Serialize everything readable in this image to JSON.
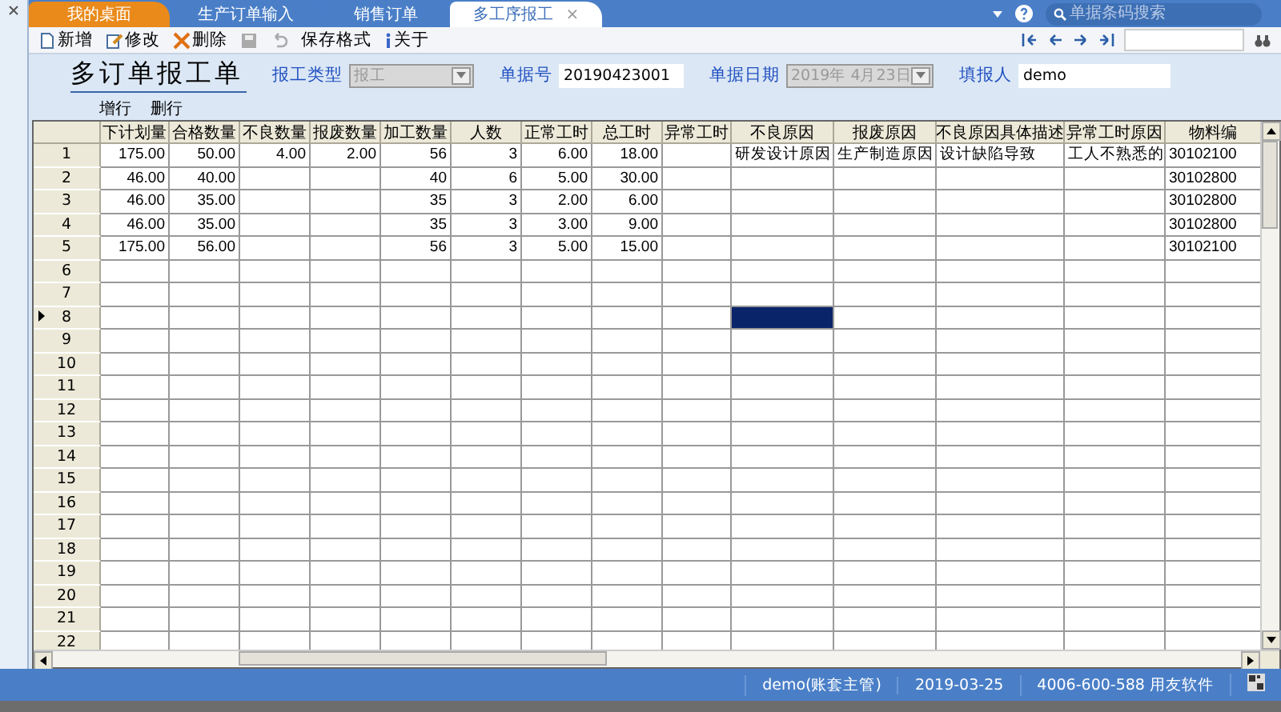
{
  "tabs": [
    {
      "label": "我的桌面",
      "kind": "home",
      "selected": false
    },
    {
      "label": "生产订单输入",
      "kind": "doc",
      "selected": false
    },
    {
      "label": "销售订单",
      "kind": "doc",
      "selected": false
    },
    {
      "label": "多工序报工",
      "kind": "doc",
      "selected": true,
      "close": "×"
    }
  ],
  "search": {
    "placeholder": "单据条码搜索"
  },
  "toolbar": [
    {
      "label": "新增",
      "kind": "new",
      "disabled": false
    },
    {
      "label": "修改",
      "kind": "edit",
      "disabled": false
    },
    {
      "label": "删除",
      "kind": "delete",
      "disabled": false
    },
    {
      "kind": "save",
      "disabled": true
    },
    {
      "kind": "undo",
      "disabled": true
    },
    {
      "label": "保存格式",
      "kind": "plain",
      "disabled": false
    },
    {
      "label": "关于",
      "kind": "info",
      "disabled": false
    }
  ],
  "form": {
    "title": "多订单报工单",
    "fields": [
      {
        "label": "报工类型",
        "value": "报工",
        "kind": "combo",
        "disabled": true
      },
      {
        "label": "单据号",
        "value": "20190423001",
        "kind": "text",
        "disabled": false
      },
      {
        "label": "单据日期",
        "value": "2019年 4月23日",
        "kind": "combo",
        "disabled": true
      },
      {
        "label": "填报人",
        "value": "demo",
        "kind": "text",
        "disabled": false
      }
    ],
    "actions": [
      "增行",
      "删行"
    ]
  },
  "grid": {
    "columns": [
      {
        "label": "下计划量",
        "kind": "number",
        "selected": false
      },
      {
        "label": "合格数量",
        "kind": "number",
        "selected": false
      },
      {
        "label": "不良数量",
        "kind": "number",
        "selected": false
      },
      {
        "label": "报废数量",
        "kind": "number",
        "selected": false
      },
      {
        "label": "加工数量",
        "kind": "number",
        "selected": false
      },
      {
        "label": "人数",
        "kind": "number",
        "selected": false
      },
      {
        "label": "正常工时",
        "kind": "number",
        "selected": false
      },
      {
        "label": "总工时",
        "kind": "number",
        "selected": false
      },
      {
        "label": "异常工时",
        "kind": "number",
        "selected": false
      },
      {
        "label": "不良原因",
        "kind": "text",
        "selected": true
      },
      {
        "label": "报废原因",
        "kind": "text",
        "selected": false
      },
      {
        "label": "不良原因具体描述",
        "kind": "text",
        "selected": false
      },
      {
        "label": "异常工时原因",
        "kind": "text",
        "selected": false
      },
      {
        "label": "物料编",
        "kind": "text",
        "selected": false
      }
    ],
    "rows": [
      {
        "number": "1",
        "current": false,
        "cells": [
          "175.00",
          "50.00",
          "4.00",
          "2.00",
          "56",
          "3",
          "6.00",
          "18.00",
          null,
          "研发设计原因",
          "生产制造原因",
          "设计缺陷导致",
          "工人不熟悉的",
          "30102100"
        ]
      },
      {
        "number": "2",
        "current": false,
        "cells": [
          "46.00",
          "40.00",
          null,
          null,
          "40",
          "6",
          "5.00",
          "30.00",
          null,
          null,
          null,
          null,
          null,
          "30102800"
        ]
      },
      {
        "number": "3",
        "current": false,
        "cells": [
          "46.00",
          "35.00",
          null,
          null,
          "35",
          "3",
          "2.00",
          "6.00",
          null,
          null,
          null,
          null,
          null,
          "30102800"
        ]
      },
      {
        "number": "4",
        "current": false,
        "cells": [
          "46.00",
          "35.00",
          null,
          null,
          "35",
          "3",
          "3.00",
          "9.00",
          null,
          null,
          null,
          null,
          null,
          "30102800"
        ]
      },
      {
        "number": "5",
        "current": false,
        "cells": [
          "175.00",
          "56.00",
          null,
          null,
          "56",
          "3",
          "5.00",
          "15.00",
          null,
          null,
          null,
          null,
          null,
          "30102100"
        ]
      },
      {
        "number": "6",
        "current": false
      },
      {
        "number": "7",
        "current": false
      },
      {
        "number": "8",
        "current": true
      },
      {
        "number": "9",
        "current": false
      },
      {
        "number": "10",
        "current": false
      },
      {
        "number": "11",
        "current": false
      },
      {
        "number": "12",
        "current": false
      },
      {
        "number": "13",
        "current": false
      },
      {
        "number": "14",
        "current": false
      },
      {
        "number": "15",
        "current": false
      },
      {
        "number": "16",
        "current": false
      },
      {
        "number": "17",
        "current": false
      },
      {
        "number": "18",
        "current": false
      },
      {
        "number": "19",
        "current": false
      },
      {
        "number": "20",
        "current": false
      },
      {
        "number": "21",
        "current": false
      },
      {
        "number": "22",
        "current": false
      }
    ]
  },
  "status_bar": {
    "user": "demo(账套主管)",
    "date": "2019-03-25",
    "vendor": "4006-600-588 用友软件"
  }
}
